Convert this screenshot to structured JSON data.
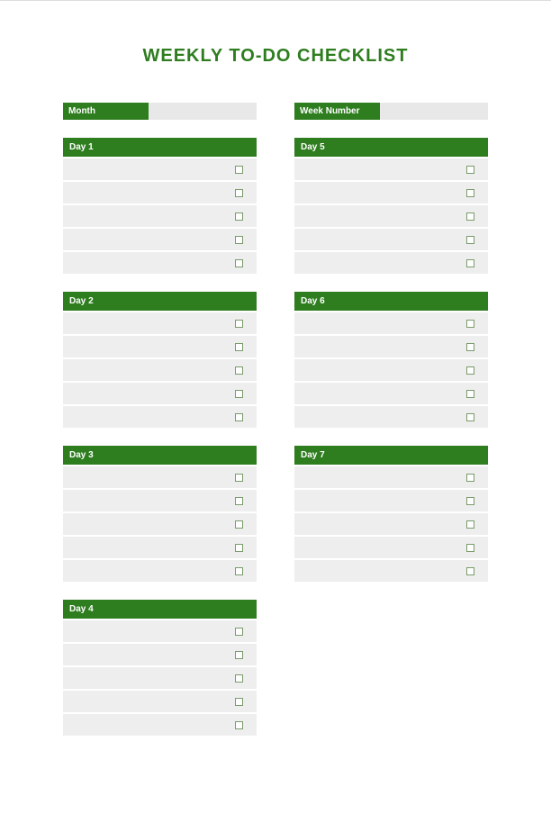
{
  "title": "WEEKLY TO-DO CHECKLIST",
  "meta": {
    "monthLabel": "Month",
    "monthValue": "",
    "weekLabel": "Week Number",
    "weekValue": ""
  },
  "leftColumn": [
    {
      "label": "Day 1",
      "tasks": [
        "",
        "",
        "",
        "",
        ""
      ]
    },
    {
      "label": "Day 2",
      "tasks": [
        "",
        "",
        "",
        "",
        ""
      ]
    },
    {
      "label": "Day 3",
      "tasks": [
        "",
        "",
        "",
        "",
        ""
      ]
    },
    {
      "label": "Day 4",
      "tasks": [
        "",
        "",
        "",
        "",
        ""
      ]
    }
  ],
  "rightColumn": [
    {
      "label": "Day 5",
      "tasks": [
        "",
        "",
        "",
        "",
        ""
      ]
    },
    {
      "label": "Day 6",
      "tasks": [
        "",
        "",
        "",
        "",
        ""
      ]
    },
    {
      "label": "Day 7",
      "tasks": [
        "",
        "",
        "",
        "",
        ""
      ]
    }
  ]
}
